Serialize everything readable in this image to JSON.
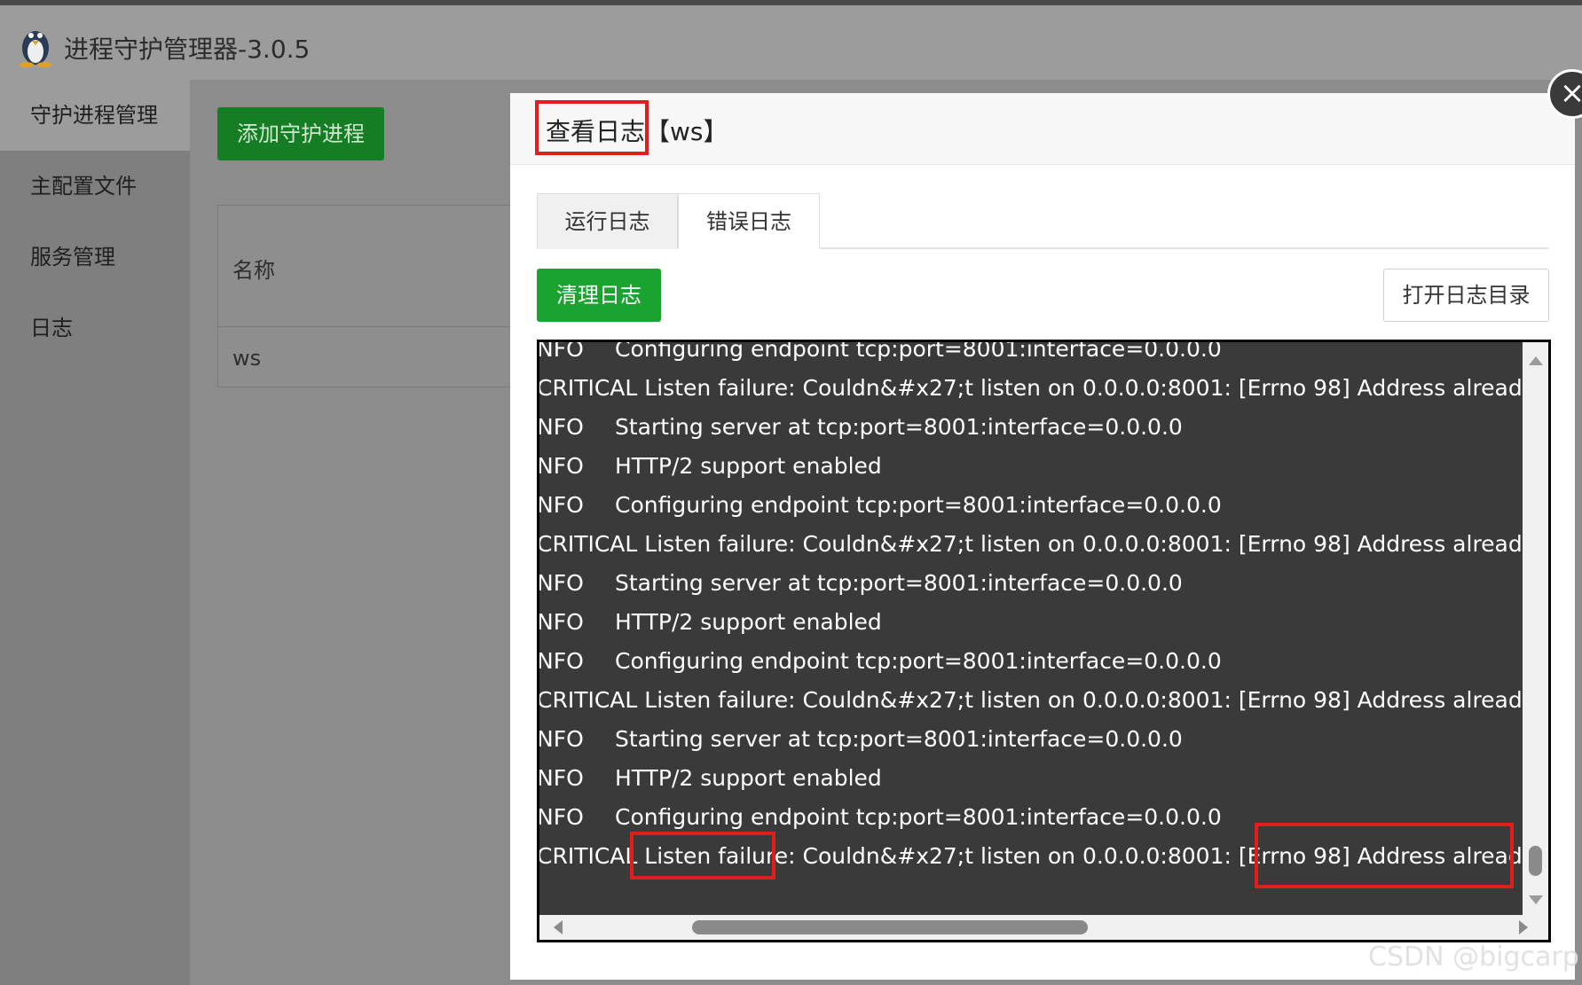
{
  "app": {
    "title": "进程守护管理器-3.0.5",
    "logo_icon": "linux-penguin-icon"
  },
  "sidebar": {
    "items": [
      {
        "label": "守护进程管理",
        "active": true
      },
      {
        "label": "主配置文件",
        "active": false
      },
      {
        "label": "服务管理",
        "active": false
      },
      {
        "label": "日志",
        "active": false
      }
    ]
  },
  "main": {
    "add_button": "添加守护进程",
    "table": {
      "header_name": "名称",
      "rows": [
        {
          "name": "ws"
        }
      ]
    }
  },
  "modal": {
    "title": "查看日志",
    "subtitle": "【ws】",
    "close_icon": "close-icon",
    "tabs": [
      {
        "label": "运行日志",
        "active": false
      },
      {
        "label": "错误日志",
        "active": true
      }
    ],
    "clear_button": "清理日志",
    "open_dir_button": "打开日志目录",
    "log_lines": [
      {
        "level": "NFO",
        "message": "Configuring endpoint tcp:port=8001:interface=0.0.0.0"
      },
      {
        "level": "CRITICAL",
        "message": "Listen failure: Couldn&#x27;t listen on 0.0.0.0:8001: [Errno 98] Address already in use."
      },
      {
        "level": "NFO",
        "message": "Starting server at tcp:port=8001:interface=0.0.0.0"
      },
      {
        "level": "NFO",
        "message": "HTTP/2 support enabled"
      },
      {
        "level": "NFO",
        "message": "Configuring endpoint tcp:port=8001:interface=0.0.0.0"
      },
      {
        "level": "CRITICAL",
        "message": "Listen failure: Couldn&#x27;t listen on 0.0.0.0:8001: [Errno 98] Address already in use."
      },
      {
        "level": "NFO",
        "message": "Starting server at tcp:port=8001:interface=0.0.0.0"
      },
      {
        "level": "NFO",
        "message": "HTTP/2 support enabled"
      },
      {
        "level": "NFO",
        "message": "Configuring endpoint tcp:port=8001:interface=0.0.0.0"
      },
      {
        "level": "CRITICAL",
        "message": "Listen failure: Couldn&#x27;t listen on 0.0.0.0:8001: [Errno 98] Address already in use."
      },
      {
        "level": "NFO",
        "message": "Starting server at tcp:port=8001:interface=0.0.0.0"
      },
      {
        "level": "NFO",
        "message": "HTTP/2 support enabled"
      },
      {
        "level": "NFO",
        "message": "Configuring endpoint tcp:port=8001:interface=0.0.0.0"
      },
      {
        "level": "CRITICAL",
        "message": "Listen failure: Couldn&#x27;t listen on 0.0.0.0:8001: [Errno 98] Address already in use."
      }
    ]
  },
  "watermark": "CSDN @bigcarp",
  "colors": {
    "primary_green": "#1aa32e",
    "annotation_red": "#e01e1e",
    "log_bg": "#3a3a3a"
  }
}
